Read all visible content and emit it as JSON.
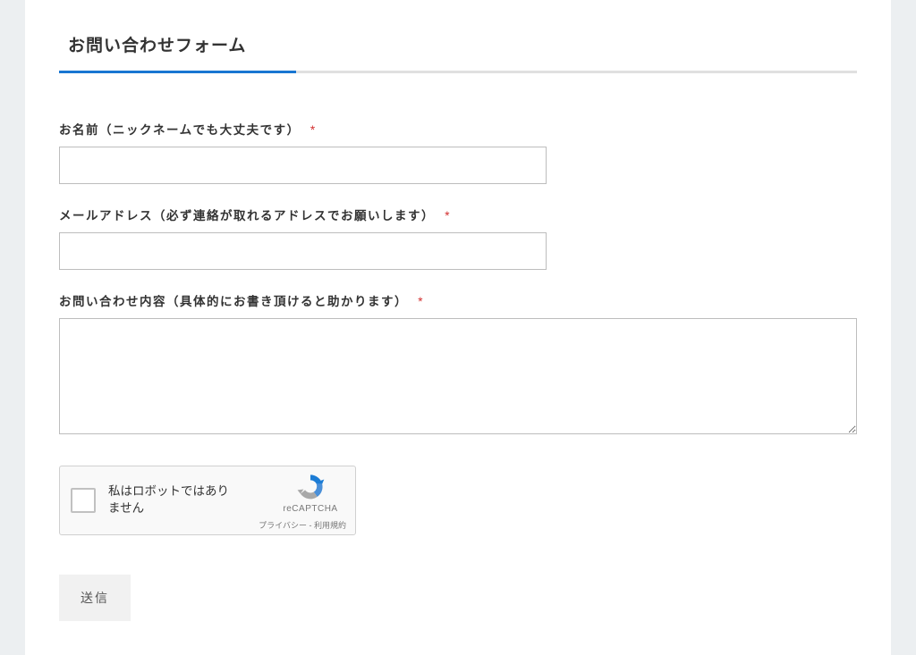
{
  "form": {
    "title": "お問い合わせフォーム",
    "fields": {
      "name": {
        "label": "お名前（ニックネームでも大丈夫です）",
        "required": "*",
        "value": ""
      },
      "email": {
        "label": "メールアドレス（必ず連絡が取れるアドレスでお願いします）",
        "required": "*",
        "value": ""
      },
      "content": {
        "label": "お問い合わせ内容（具体的にお書き頂けると助かります）",
        "required": "*",
        "value": ""
      }
    },
    "recaptcha": {
      "label": "私はロボットではありません",
      "brand": "reCAPTCHA",
      "privacy": "プライバシー",
      "separator": " - ",
      "terms": "利用規約"
    },
    "submit_label": "送信"
  }
}
